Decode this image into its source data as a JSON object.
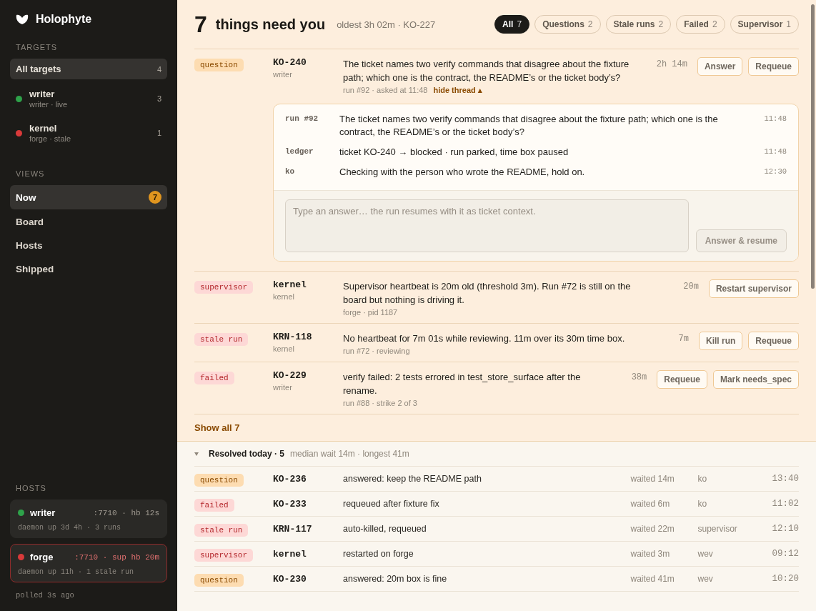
{
  "brand": {
    "name": "Holophyte"
  },
  "sidebar": {
    "targets_heading": "TARGETS",
    "targets": [
      {
        "name": "All targets",
        "count": "4",
        "selected": true
      },
      {
        "name": "writer",
        "sub": "writer · live",
        "count": "3",
        "selected": false,
        "color": "#2ea24a"
      },
      {
        "name": "kernel",
        "sub": "forge · stale",
        "count": "1",
        "selected": false,
        "color": "#d93a3a"
      }
    ],
    "views_heading": "VIEWS",
    "views": [
      {
        "label": "Now",
        "badge": "7",
        "selected": true
      },
      {
        "label": "Board",
        "selected": false
      },
      {
        "label": "Hosts",
        "selected": false
      },
      {
        "label": "Shipped",
        "selected": false
      }
    ],
    "hosts_heading": "HOSTS",
    "hosts": [
      {
        "name": "writer",
        "alert": false,
        "color": "#2ea24a",
        "meta": ":7710 · hb 12s",
        "detail": "daemon up 3d 4h · 3 runs"
      },
      {
        "name": "forge",
        "alert": true,
        "color": "#d93a3a",
        "meta": ":7710 · sup hb 20m",
        "detail": "daemon up 11h · 1 stale run"
      }
    ],
    "polled": "polled 3s ago"
  },
  "header": {
    "count": "7",
    "title": "things need you",
    "subtitle": "oldest 3h 02m · KO-227"
  },
  "filters": [
    {
      "label": "All",
      "count": "7",
      "selected": true
    },
    {
      "label": "Questions",
      "count": "2",
      "selected": false
    },
    {
      "label": "Stale runs",
      "count": "2",
      "selected": false
    },
    {
      "label": "Failed",
      "count": "2",
      "selected": false
    },
    {
      "label": "Supervisor",
      "count": "1",
      "selected": false
    }
  ],
  "items": [
    {
      "kind": "question",
      "tag": "question",
      "id": "KO-240",
      "target": "writer",
      "text": "The ticket names two verify commands that disagree about the fixture path; which one is the contract, the README’s or the ticket body’s?",
      "meta": "run #92 · asked at 11:48",
      "thread_toggle": "hide thread ▴",
      "age": "2h 14m",
      "actions": [
        "Answer",
        "Requeue"
      ],
      "thread": {
        "expanded": true,
        "messages": [
          {
            "from": "run #92",
            "text": "The ticket names two verify commands that disagree about the fixture path; which one is the contract, the README’s or the ticket body’s?",
            "time": "11:48"
          },
          {
            "from": "ledger",
            "text": "ticket KO-240 → blocked · run parked, time box paused",
            "time": "11:48"
          },
          {
            "from": "ko",
            "text": "Checking with the person who wrote the README, hold on.",
            "time": "12:30"
          }
        ],
        "placeholder": "Type an answer… the run resumes with it as ticket context.",
        "submit": {
          "label": "Answer & resume",
          "disabled": true
        }
      }
    },
    {
      "kind": "alert",
      "tag": "supervisor",
      "id": "kernel",
      "target": "kernel",
      "text": "Supervisor heartbeat is 20m old (threshold 3m). Run #72 is still on the board but nothing is driving it.",
      "meta": "forge · pid 1187",
      "age": "20m",
      "actions": [
        "Restart supervisor"
      ]
    },
    {
      "kind": "alert",
      "tag": "stale run",
      "id": "KRN-118",
      "target": "kernel",
      "text": "No heartbeat for 7m 01s while reviewing. 11m over its 30m time box.",
      "meta": "run #72 · reviewing",
      "age": "7m",
      "actions": [
        "Kill run",
        "Requeue"
      ]
    },
    {
      "kind": "alert",
      "tag": "failed",
      "id": "KO-229",
      "target": "writer",
      "text": "verify failed: 2 tests errored in test_store_surface after the rename.",
      "meta": "run #88 · strike 2 of 3",
      "age": "38m",
      "actions": [
        "Requeue",
        "Mark needs_spec"
      ]
    }
  ],
  "show_all": "Show all 7",
  "resolved": {
    "expanded": true,
    "title": "Resolved today · 5",
    "summary": "median wait 14m · longest 41m",
    "rows": [
      {
        "kind": "question",
        "tag": "question",
        "id": "KO-236",
        "text": "answered: keep the README path",
        "waited": "waited 14m",
        "by": "ko",
        "time": "13:40"
      },
      {
        "kind": "alert",
        "tag": "failed",
        "id": "KO-233",
        "text": "requeued after fixture fix",
        "waited": "waited 6m",
        "by": "ko",
        "time": "11:02"
      },
      {
        "kind": "alert",
        "tag": "stale run",
        "id": "KRN-117",
        "text": "auto-killed, requeued",
        "waited": "waited 22m",
        "by": "supervisor",
        "time": "12:10"
      },
      {
        "kind": "alert",
        "tag": "supervisor",
        "id": "kernel",
        "text": "restarted on forge",
        "waited": "waited 3m",
        "by": "wev",
        "time": "09:12"
      },
      {
        "kind": "question",
        "tag": "question",
        "id": "KO-230",
        "text": "answered: 20m box is fine",
        "waited": "waited 41m",
        "by": "wev",
        "time": "10:20"
      }
    ]
  }
}
